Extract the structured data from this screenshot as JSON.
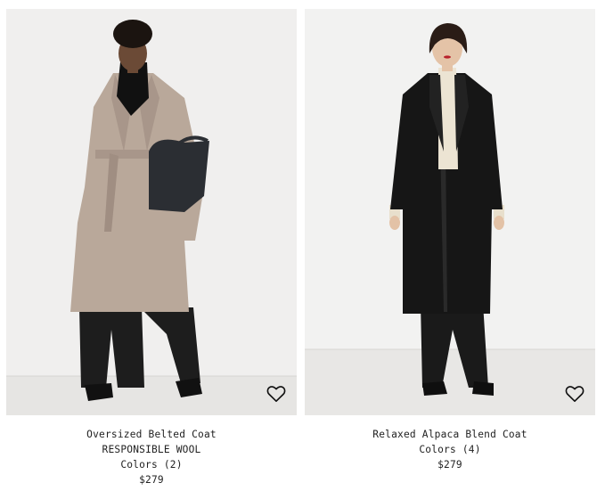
{
  "products": [
    {
      "name": "Oversized Belted Coat",
      "tag": "RESPONSIBLE WOOL",
      "colors": "Colors (2)",
      "price": "$279",
      "image_icon": "model-in-beige-coat-photo",
      "coat_color": "#b9a89a",
      "wishlist_icon": "heart-outline-icon"
    },
    {
      "name": "Relaxed Alpaca Blend Coat",
      "colors": "Colors (4)",
      "price": "$279",
      "image_icon": "model-in-black-coat-photo",
      "coat_color": "#161616",
      "wishlist_icon": "heart-outline-icon"
    }
  ]
}
